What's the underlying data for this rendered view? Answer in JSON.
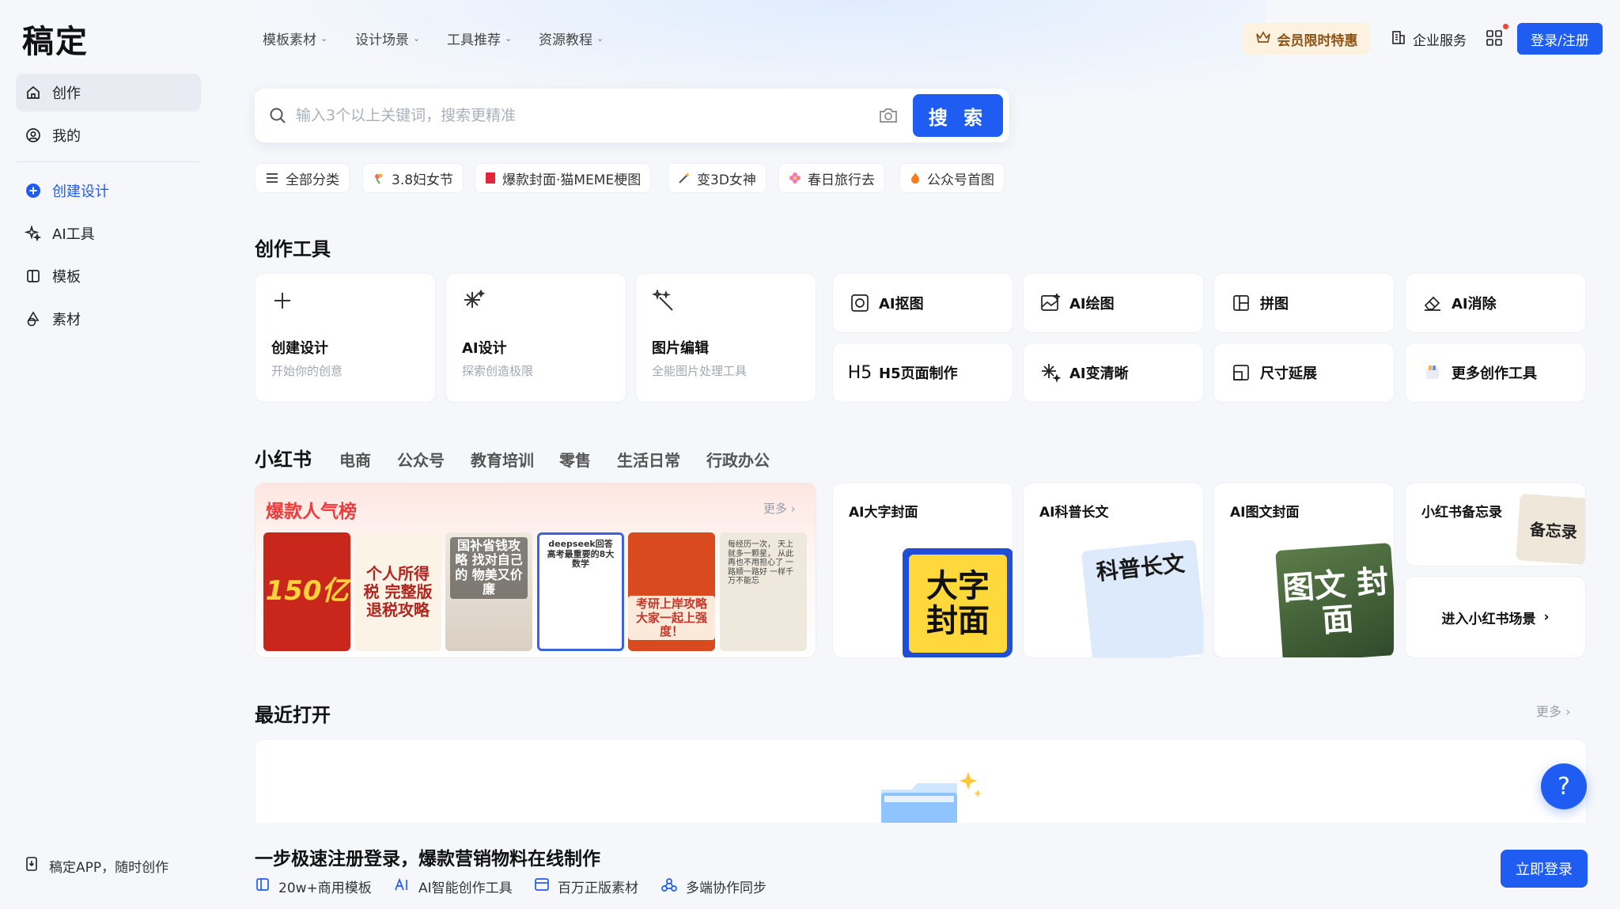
{
  "app": {
    "logo": "稿定"
  },
  "sidebar": {
    "items": [
      {
        "label": "创作",
        "icon": "home-icon"
      },
      {
        "label": "我的",
        "icon": "user-icon"
      },
      {
        "label": "创建设计",
        "icon": "plus-circle-icon"
      },
      {
        "label": "AI工具",
        "icon": "sparkle-icon"
      },
      {
        "label": "模板",
        "icon": "template-icon"
      },
      {
        "label": "素材",
        "icon": "shapes-icon"
      }
    ],
    "app_promo": "稿定APP，随时创作"
  },
  "header": {
    "nav": [
      "模板素材",
      "设计场景",
      "工具推荐",
      "资源教程"
    ],
    "vip": "会员限时特惠",
    "enterprise": "企业服务",
    "login": "登录/注册"
  },
  "search": {
    "placeholder": "输入3个以上关键词，搜索更精准",
    "button": "搜 索",
    "chips": [
      "全部分类",
      "3.8妇女节",
      "爆款封面·猫MEME梗图",
      "变3D女神",
      "春日旅行去",
      "公众号首图"
    ]
  },
  "tools": {
    "title": "创作工具",
    "big": [
      {
        "name": "创建设计",
        "desc": "开始你的创意",
        "icon": "plus-icon"
      },
      {
        "name": "AI设计",
        "desc": "探索创造极限",
        "icon": "sparkle-icon"
      },
      {
        "name": "图片编辑",
        "desc": "全能图片处理工具",
        "icon": "magic-wand-icon"
      }
    ],
    "small": [
      {
        "name": "AI抠图",
        "icon": "cutout-icon"
      },
      {
        "name": "AI绘图",
        "icon": "image-icon"
      },
      {
        "name": "拼图",
        "icon": "collage-icon"
      },
      {
        "name": "AI消除",
        "icon": "eraser-icon"
      },
      {
        "name": "H5页面制作",
        "icon": "h5-icon"
      },
      {
        "name": "AI变清晰",
        "icon": "sparkle-icon"
      },
      {
        "name": "尺寸延展",
        "icon": "resize-icon"
      },
      {
        "name": "更多创作工具",
        "icon": "more-tools-icon"
      }
    ]
  },
  "categories": {
    "tabs": [
      "小红书",
      "电商",
      "公众号",
      "教育培训",
      "零售",
      "生活日常",
      "行政办公"
    ]
  },
  "hot": {
    "title": "爆款人气榜",
    "more": "更多",
    "thumbs": [
      {
        "text": "150亿",
        "bg": "#c9261c",
        "fg": "#ffd23a"
      },
      {
        "text": "个人所得税 完整版 退税攻略",
        "bg": "#fbf3e6",
        "fg": "#222"
      },
      {
        "text": "国补省钱攻略 找对自己的 物美又价廉",
        "bg": "#e9e3da",
        "fg": "#fff"
      },
      {
        "text": "deepseek回答 高考最重要的8大数学",
        "bg": "#ffffff",
        "fg": "#333"
      },
      {
        "text": "考研上岸攻略 大家一起上强度！",
        "bg": "#d94a1f",
        "fg": "#fff"
      },
      {
        "text": "每经历一次， 天上就多一颗星， 从此再也不用担心了 一路顺一路好 一样千万不能忘",
        "bg": "#efe8dc",
        "fg": "#444"
      }
    ]
  },
  "features": [
    {
      "title": "AI大字封面",
      "art": "大字 封面"
    },
    {
      "title": "AI科普长文",
      "art": "科普长文"
    },
    {
      "title": "AI图文封面",
      "art": "图文 封面"
    }
  ],
  "memo": {
    "title": "小红书备忘录",
    "art": "备忘录"
  },
  "enter_scene": "进入小红书场景",
  "recent": {
    "title": "最近打开",
    "more": "更多"
  },
  "promo": {
    "title": "一步极速注册登录，爆款营销物料在线制作",
    "features": [
      "20w+商用模板",
      "AI智能创作工具",
      "百万正版素材",
      "多端协作同步"
    ],
    "login": "立即登录"
  },
  "colors": {
    "brand": "#1f5cf1",
    "hot_red": "#ef3b3b",
    "vip_bg": "#fdf1df"
  }
}
